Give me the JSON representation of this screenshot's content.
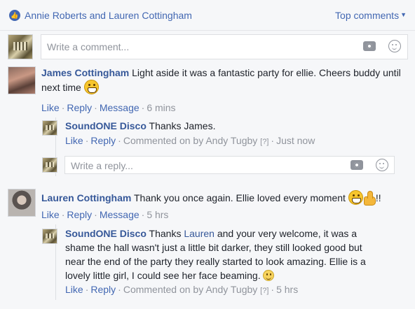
{
  "likes": {
    "names": "Annie Roberts and Lauren Cottingham"
  },
  "sort": {
    "label": "Top comments",
    "caret": "▼"
  },
  "composer": {
    "placeholder": "Write a comment..."
  },
  "comments": [
    {
      "author": "James Cottingham",
      "text": "Light aside it was a fantastic party for ellie. Cheers buddy until next time",
      "actions": {
        "like": "Like",
        "reply": "Reply",
        "message": "Message",
        "time": "6 mins"
      },
      "replies": [
        {
          "author": "SoundONE Disco",
          "text": "Thanks James.",
          "actions": {
            "like": "Like",
            "reply": "Reply",
            "commented_by": "Commented on by Andy Tugby",
            "qmark": "[?]",
            "time": "Just now"
          }
        }
      ],
      "reply_box": {
        "placeholder": "Write a reply..."
      }
    },
    {
      "author": "Lauren Cottingham",
      "text": "Thank you once again. Ellie loved every moment",
      "text_suffix": "!!",
      "actions": {
        "like": "Like",
        "reply": "Reply",
        "message": "Message",
        "time": "5 hrs"
      },
      "replies": [
        {
          "author": "SoundONE Disco",
          "text_before": "Thanks",
          "mention": "Lauren",
          "text": "and your very welcome, it was a shame the hall wasn't just a little bit darker, they still looked good but near the end of the party they really started to look amazing. Ellie is a lovely little girl, I could see her face beaming.",
          "actions": {
            "like": "Like",
            "reply": "Reply",
            "commented_by": "Commented on by Andy Tugby",
            "qmark": "[?]",
            "time": "5 hrs"
          }
        }
      ]
    }
  ],
  "colors": {
    "link": "#4267b2",
    "author": "#365899",
    "meta": "#90949c",
    "background": "#f6f7f9"
  },
  "icons": [
    "like-thumb-icon",
    "camera-icon",
    "emoji-smile-icon",
    "grin-emoji",
    "thumbs-up-emoji",
    "smile-emoji"
  ]
}
